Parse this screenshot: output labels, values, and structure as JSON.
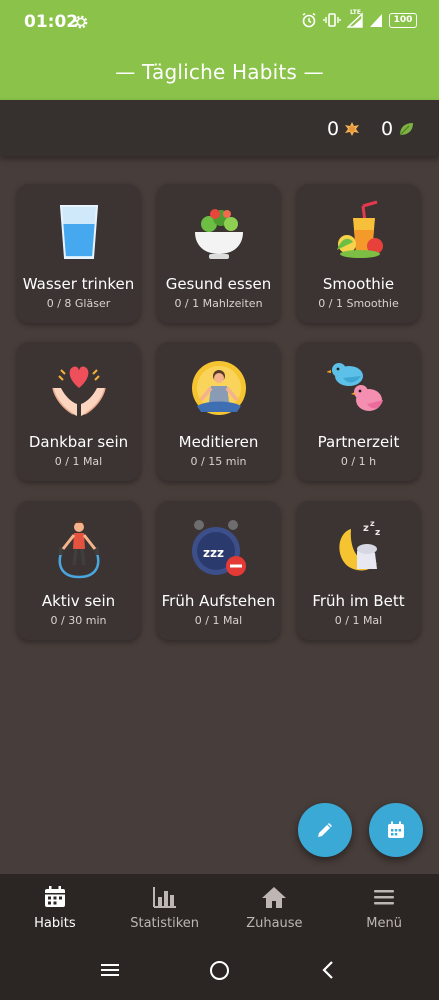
{
  "status": {
    "time": "01:02",
    "battery": "100",
    "network": "LTE"
  },
  "header": {
    "title": "— Tägliche Habits —"
  },
  "counters": [
    {
      "value": "0",
      "icon": "coin-icon"
    },
    {
      "value": "0",
      "icon": "leaf-icon"
    }
  ],
  "habits": [
    {
      "name": "Wasser trinken",
      "progress": "0 / 8 Gläser",
      "icon": "water-glass-icon"
    },
    {
      "name": "Gesund essen",
      "progress": "0 / 1 Mahlzeiten",
      "icon": "salad-icon"
    },
    {
      "name": "Smoothie",
      "progress": "0 / 1 Smoothie",
      "icon": "smoothie-icon"
    },
    {
      "name": "Dankbar sein",
      "progress": "0 / 1 Mal",
      "icon": "heart-hands-icon"
    },
    {
      "name": "Meditieren",
      "progress": "0 / 15 min",
      "icon": "meditation-icon"
    },
    {
      "name": "Partnerzeit",
      "progress": "0 / 1 h",
      "icon": "birds-icon"
    },
    {
      "name": "Aktiv sein",
      "progress": "0 / 30 min",
      "icon": "jump-rope-icon"
    },
    {
      "name": "Früh Aufstehen",
      "progress": "0 / 1 Mal",
      "icon": "alarm-clock-icon"
    },
    {
      "name": "Früh im Bett",
      "progress": "0 / 1 Mal",
      "icon": "sleep-moon-icon"
    }
  ],
  "nav": [
    {
      "label": "Habits",
      "icon": "calendar-icon",
      "active": true
    },
    {
      "label": "Statistiken",
      "icon": "bar-chart-icon",
      "active": false
    },
    {
      "label": "Zuhause",
      "icon": "home-icon",
      "active": false
    },
    {
      "label": "Menü",
      "icon": "menu-icon",
      "active": false
    }
  ],
  "colors": {
    "header": "#8bc34a",
    "background": "#473d3a",
    "card": "#3c3432",
    "fab": "#3aa9d6"
  }
}
